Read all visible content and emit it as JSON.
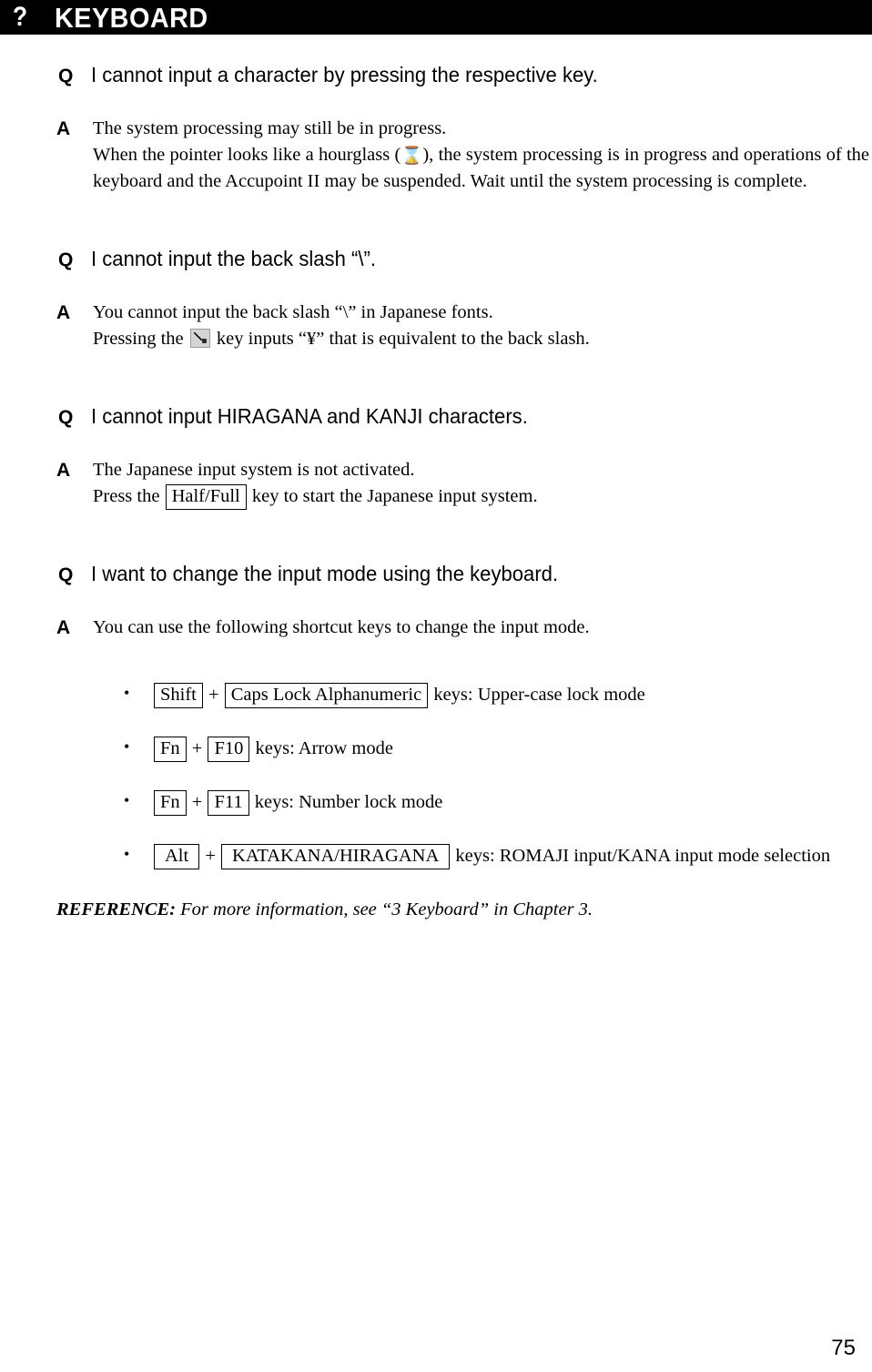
{
  "header": {
    "icon": "question-mark",
    "icon_glyph": "?",
    "title": "KEYBOARD",
    "background_color": "#000000",
    "text_color": "#ffffff"
  },
  "page_number": "75",
  "qa": [
    {
      "marker_q": "Q",
      "question": "I cannot input a character by pressing the respective key.",
      "marker_a": "A",
      "answer_lines": [
        "The system processing may still be in progress.",
        "When the pointer looks like a hourglass (",
        "), the system processing is in progress and operations of the keyboard and the Accupoint II may be suspended. Wait until the system processing is complete."
      ],
      "hourglass_glyph": "⌛"
    },
    {
      "marker_q": "Q",
      "question": "I cannot input the back slash “\\”.",
      "marker_a": "A",
      "answer_lines": [
        "You cannot input the back slash “\\” in Japanese fonts.",
        "Pressing the ",
        " key inputs “¥” that is equivalent to the back slash."
      ],
      "key_icon_name": "backslash-key-icon"
    },
    {
      "marker_q": "Q",
      "question": "I cannot input HIRAGANA and KANJI characters.",
      "marker_a": "A",
      "answer_lines": [
        "The Japanese input system is not activated.",
        "Press the ",
        " key to start the Japanese input system."
      ],
      "keycap": "Half/Full"
    },
    {
      "marker_q": "Q",
      "question": "I want to change the input mode using the keyboard.",
      "marker_a": "A",
      "answer_lines": [
        "You can use the following shortcut keys to change the input mode."
      ],
      "bullets": [
        {
          "key1": "Shift",
          "plus": "+",
          "key2": "Caps Lock Alphanumeric",
          "tail": " keys: Upper-case lock mode"
        },
        {
          "key1": "Fn",
          "plus": "+",
          "key2": "F10",
          "tail": " keys: Arrow mode"
        },
        {
          "key1": "Fn",
          "plus": "+",
          "key2": "F11",
          "tail": " keys: Number lock mode"
        },
        {
          "key1": "Alt",
          "plus": "+",
          "key2": "KATAKANA/HIRAGANA",
          "tail": " keys: ROMAJI input/KANA input mode selection"
        }
      ]
    }
  ],
  "reference": {
    "label": "REFERENCE:",
    "text": " For more information, see “3 Keyboard” in Chapter 3."
  },
  "bullet_glyph": "•"
}
